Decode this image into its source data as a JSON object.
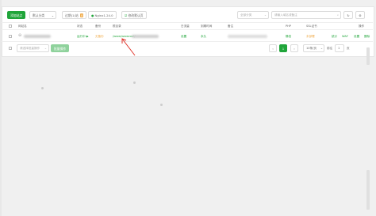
{
  "toolbar": {
    "add_site": "添加站点",
    "category": "默认分类",
    "expired": "过期(1)站",
    "expired_badge": "0",
    "nginx": "Nginx1.24.0",
    "modify_default": "修改默认页",
    "search_placeholder": "全部分类",
    "search_input_placeholder": "请输入域名或备注"
  },
  "table": {
    "headers": [
      "网站名",
      "状态",
      "备份",
      "根目录",
      "日流量",
      "到期时间",
      "备注",
      "PHP",
      "SSL证书",
      "操作"
    ],
    "row": {
      "status": "运行中 ▶",
      "backup": "无备份",
      "root": "/www/wwwroot/",
      "traffic": "设置",
      "expire": "永久",
      "php": "静态",
      "ssl": "未部署",
      "actions": [
        "统计",
        "WAF",
        "设置",
        "删除"
      ]
    }
  },
  "footer": {
    "batch_placeholder": "请选择批量操作",
    "batch_button": "批量操作",
    "current_page": "1",
    "per_page": "10条/页",
    "goto": "前往",
    "page_input": "1",
    "page_unit": "页"
  },
  "colors": {
    "accent": "#20a53a",
    "warning": "#f0ad4e",
    "danger": "#e0362c"
  }
}
